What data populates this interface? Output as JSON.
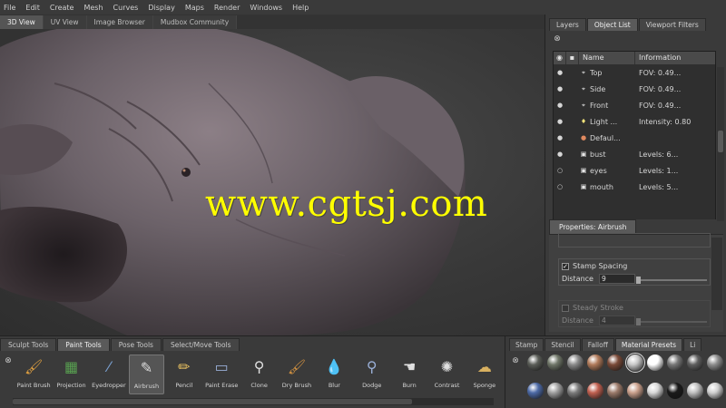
{
  "menubar": {
    "items": [
      "File",
      "Edit",
      "Create",
      "Mesh",
      "Curves",
      "Display",
      "Maps",
      "Render",
      "Windows",
      "Help"
    ]
  },
  "view_tabs": [
    "3D View",
    "UV View",
    "Image Browser",
    "Mudbox Community"
  ],
  "watermark": "www.cgtsj.com",
  "right_panel": {
    "tabs": [
      "Layers",
      "Object List",
      "Viewport Filters"
    ],
    "active_tab": "Object List",
    "columns": [
      "Name",
      "Information"
    ],
    "objects": [
      {
        "name": "Top",
        "info": "FOV: 0.49...",
        "visible": "filled",
        "icon": "camera-icon"
      },
      {
        "name": "Side",
        "info": "FOV: 0.49...",
        "visible": "filled",
        "icon": "camera-icon"
      },
      {
        "name": "Front",
        "info": "FOV: 0.49...",
        "visible": "filled",
        "icon": "camera-icon"
      },
      {
        "name": "Light ...",
        "info": "Intensity: 0.80",
        "visible": "filled",
        "icon": "light-icon"
      },
      {
        "name": "Defaul...",
        "info": "",
        "visible": "filled",
        "icon": "material-icon"
      },
      {
        "name": "bust",
        "info": "Levels: 6...",
        "visible": "filled",
        "icon": "mesh-icon"
      },
      {
        "name": "eyes",
        "info": "Levels: 1...",
        "visible": "empty",
        "icon": "mesh-icon"
      },
      {
        "name": "mouth",
        "info": "Levels: 5...",
        "visible": "empty",
        "icon": "mesh-icon"
      }
    ]
  },
  "properties": {
    "tab_label": "Properties: Airbrush",
    "stamp_spacing_label": "Stamp Spacing",
    "stamp_spacing_checked": true,
    "distance_label": "Distance",
    "distance_value": "9",
    "steady_stroke_label": "Steady Stroke",
    "steady_stroke_checked": false,
    "steady_distance_label": "Distance",
    "steady_distance_value": "4"
  },
  "tool_tray": {
    "tabs": [
      "Sculpt Tools",
      "Paint Tools",
      "Pose Tools",
      "Select/Move Tools"
    ],
    "active_tab": "Paint Tools",
    "tools": [
      {
        "label": "Paint Brush",
        "icon": "paint-brush-icon",
        "active": false
      },
      {
        "label": "Projection",
        "icon": "projection-icon",
        "active": false
      },
      {
        "label": "Eyedropper",
        "icon": "eyedropper-icon",
        "active": false
      },
      {
        "label": "Airbrush",
        "icon": "airbrush-icon",
        "active": true
      },
      {
        "label": "Pencil",
        "icon": "pencil-icon",
        "active": false
      },
      {
        "label": "Paint Erase",
        "icon": "paint-erase-icon",
        "active": false
      },
      {
        "label": "Clone",
        "icon": "clone-icon",
        "active": false
      },
      {
        "label": "Dry Brush",
        "icon": "dry-brush-icon",
        "active": false
      },
      {
        "label": "Blur",
        "icon": "blur-icon",
        "active": false
      },
      {
        "label": "Dodge",
        "icon": "dodge-icon",
        "active": false
      },
      {
        "label": "Burn",
        "icon": "burn-icon",
        "active": false
      },
      {
        "label": "Contrast",
        "icon": "contrast-icon",
        "active": false
      },
      {
        "label": "Sponge",
        "icon": "sponge-icon",
        "active": false
      }
    ]
  },
  "material_panel": {
    "tabs": [
      "Stamp",
      "Stencil",
      "Falloff",
      "Material Presets",
      "Li"
    ],
    "active_tab": "Material Presets",
    "swatches": [
      "#5b5e58",
      "#6f7668",
      "#8a8a8a",
      "#b07a5a",
      "#7a4a38",
      "#c8c8c8",
      "#ffffff",
      "#777777",
      "#5e5e5e",
      "#8c8c8c",
      "#4d6aa6",
      "#a0a0a0",
      "#7c7c7c",
      "#c06050",
      "#9b7a6a",
      "#caa08c",
      "#d8d8d8",
      "#1a1a1a",
      "#bfbfbf",
      "#d0d0d0"
    ],
    "selected_index": 5
  },
  "colors": {
    "accent": "#5a5a5a",
    "watermark": "#ffff00",
    "background": "#2b2b2b"
  }
}
